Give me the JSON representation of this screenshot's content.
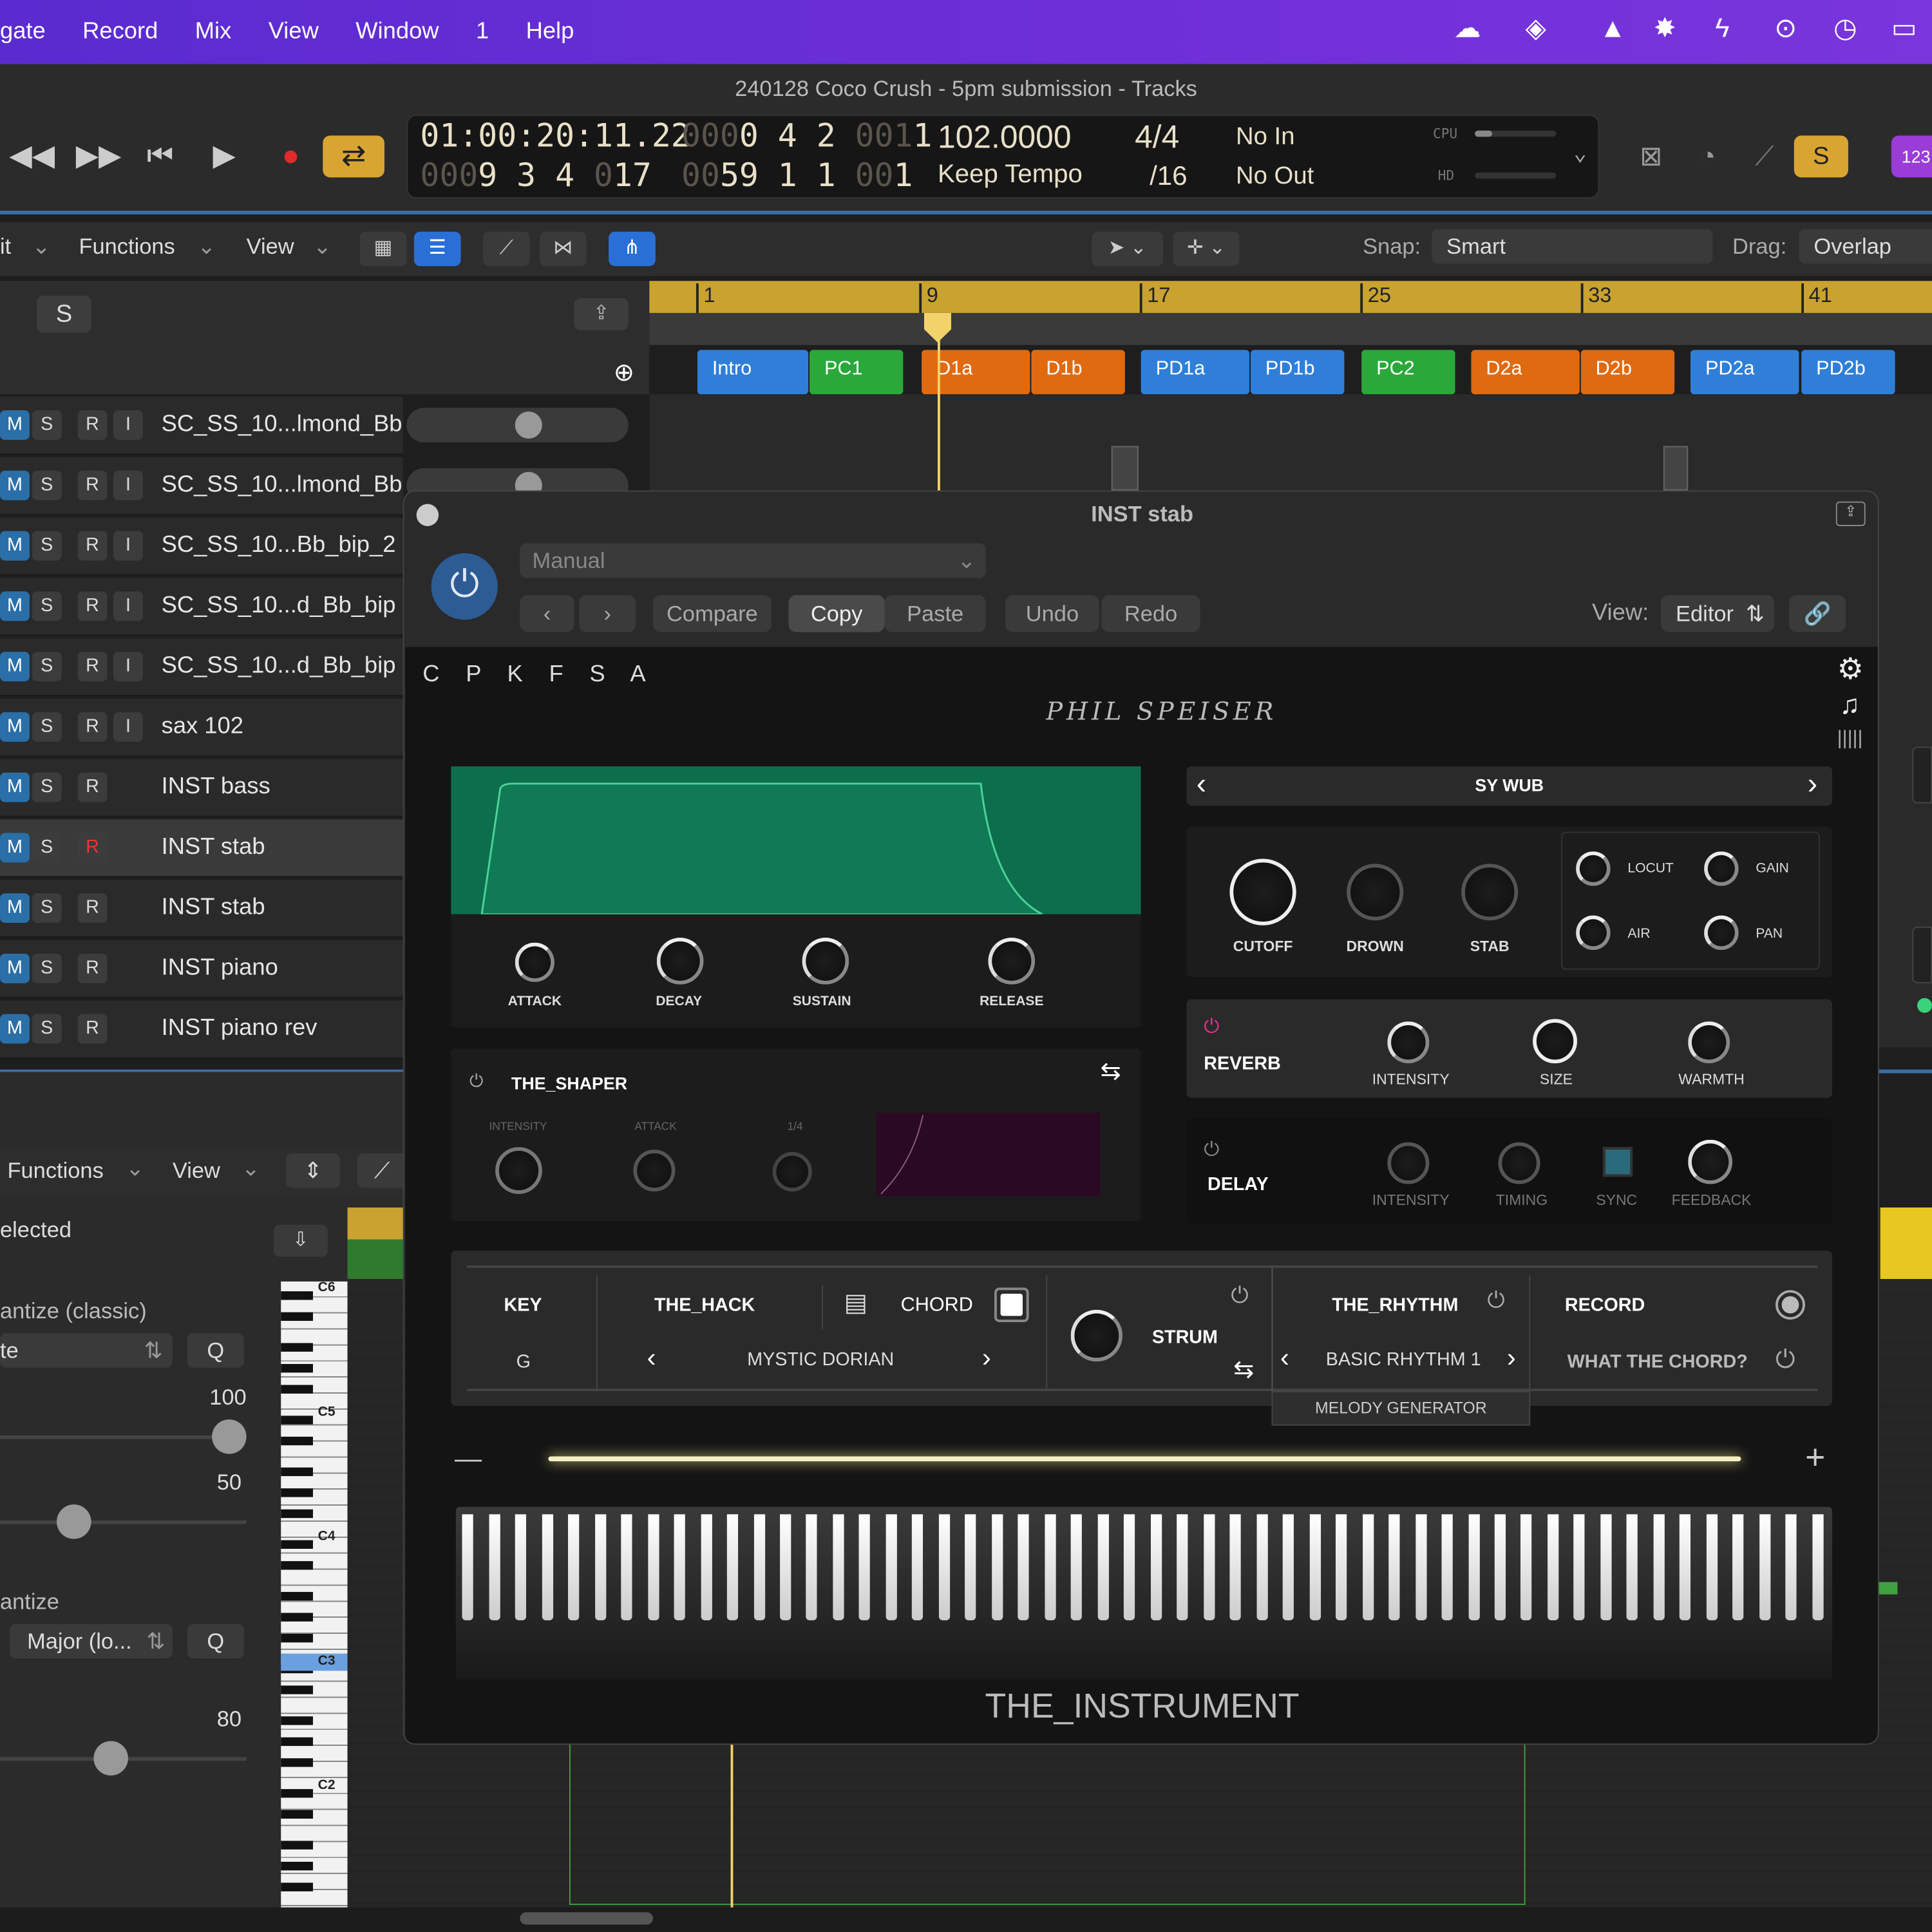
{
  "menubar": {
    "items": [
      "gate",
      "Record",
      "Mix",
      "View",
      "Window",
      "1",
      "Help"
    ]
  },
  "window_title": "240128 Coco Crush - 5pm submission - Tracks",
  "lcd": {
    "time": "01:00:20:11.22",
    "bars_a_dim": "000",
    "bars_a": "0 4 2",
    "bars_a_dim2": "001",
    "bars_a_end": "1",
    "bars_b_dim": "000",
    "bars_b": "9 3 4",
    "bars_b_dim2": "0",
    "bars_b_end": "17",
    "pos_c_dim": "000",
    "pos_c": "0 4 2",
    "pos_c_dim2": "00",
    "pos_c_end": "1",
    "pos_d_dim": "00",
    "pos_d": "59 1 1",
    "pos_d_dim2": "00",
    "pos_d_end": "1",
    "tempo": "102.0000",
    "tempo_mode": "Keep Tempo",
    "sig": "4/4",
    "div": "/16",
    "in": "No In",
    "out": "No Out",
    "cpu": "CPU",
    "hd": "HD"
  },
  "toolbar": {
    "edit": "it",
    "functions": "Functions",
    "view": "View",
    "snap_label": "Snap:",
    "snap_value": "Smart",
    "drag_label": "Drag:",
    "drag_value": "Overlap",
    "s_btn": "S"
  },
  "ruler": [
    "1",
    "9",
    "17",
    "25",
    "33",
    "41"
  ],
  "markers": [
    {
      "label": "Intro",
      "color": "#2f7fd8"
    },
    {
      "label": "PC1",
      "color": "#2aa83a"
    },
    {
      "label": "D1a",
      "color": "#e06a10"
    },
    {
      "label": "D1b",
      "color": "#e06a10"
    },
    {
      "label": "PD1a",
      "color": "#2f7fd8"
    },
    {
      "label": "PD1b",
      "color": "#2f7fd8"
    },
    {
      "label": "PC2",
      "color": "#2aa83a"
    },
    {
      "label": "D2a",
      "color": "#e06a10"
    },
    {
      "label": "D2b",
      "color": "#e06a10"
    },
    {
      "label": "PD2a",
      "color": "#2f7fd8"
    },
    {
      "label": "PD2b",
      "color": "#2f7fd8"
    }
  ],
  "tracks": [
    {
      "name": "SC_SS_10...lmond_Bb",
      "i": true
    },
    {
      "name": "SC_SS_10...lmond_Bb",
      "i": true
    },
    {
      "name": "SC_SS_10...Bb_bip_2",
      "i": true
    },
    {
      "name": "SC_SS_10...d_Bb_bip",
      "i": true
    },
    {
      "name": "SC_SS_10...d_Bb_bip",
      "i": true
    },
    {
      "name": "sax 102",
      "i": true
    },
    {
      "name": "INST bass",
      "i": false
    },
    {
      "name": "INST stab",
      "i": false
    },
    {
      "name": "INST stab",
      "i": false
    },
    {
      "name": "INST piano",
      "i": false
    },
    {
      "name": "INST piano rev",
      "i": false
    }
  ],
  "track_btns": {
    "m": "M",
    "s": "S",
    "r": "R",
    "i": "I"
  },
  "lower": {
    "functions": "Functions",
    "view": "View",
    "selected": "elected",
    "quantize": "antize (classic)",
    "q_value": "te",
    "q_btn": "Q",
    "v100": "100",
    "v50": "50",
    "scale_quantize": "antize",
    "scale_value": "Major (lo...",
    "v80": "80"
  },
  "piano_labels": [
    "C6",
    "C5",
    "C4",
    "C3",
    "C2"
  ],
  "plugin": {
    "title": "INST stab",
    "preset": "Manual",
    "compare": "Compare",
    "copy": "Copy",
    "paste": "Paste",
    "undo": "Undo",
    "redo": "Redo",
    "view_label": "View:",
    "view_value": "Editor"
  },
  "instrument": {
    "tabs": "C P K F S A",
    "brand": "PHIL SPEISER",
    "env": [
      "ATTACK",
      "DECAY",
      "SUSTAIN",
      "RELEASE"
    ],
    "preset": "SY WUB",
    "macros": [
      "CUTOFF",
      "DROWN",
      "STAB"
    ],
    "mini": [
      "LOCUT",
      "GAIN",
      "AIR",
      "PAN"
    ],
    "shaper": "THE_SHAPER",
    "shaper_k": [
      "INTENSITY",
      "ATTACK",
      "1/4"
    ],
    "reverb": "REVERB",
    "reverb_k": [
      "INTENSITY",
      "SIZE",
      "WARMTH"
    ],
    "delay": "DELAY",
    "delay_k": [
      "INTENSITY",
      "TIMING",
      "SYNC",
      "FEEDBACK"
    ],
    "key_label": "KEY",
    "key_value": "G",
    "hack": "THE_HACK",
    "chord": "CHORD",
    "mode": "MYSTIC DORIAN",
    "strum": "STRUM",
    "rhythm": "THE_RHYTHM",
    "rhythm_value": "BASIC RHYTHM 1",
    "record": "RECORD",
    "wtc": "WHAT THE CHORD?",
    "melody": "MELODY GENERATOR",
    "name": "THE_INSTRUMENT"
  },
  "colors": {
    "menubar": "#6a2fd6",
    "accent": "#3a6ea5",
    "ruler": "#c9a22f",
    "env_green": "#0f7a55"
  }
}
